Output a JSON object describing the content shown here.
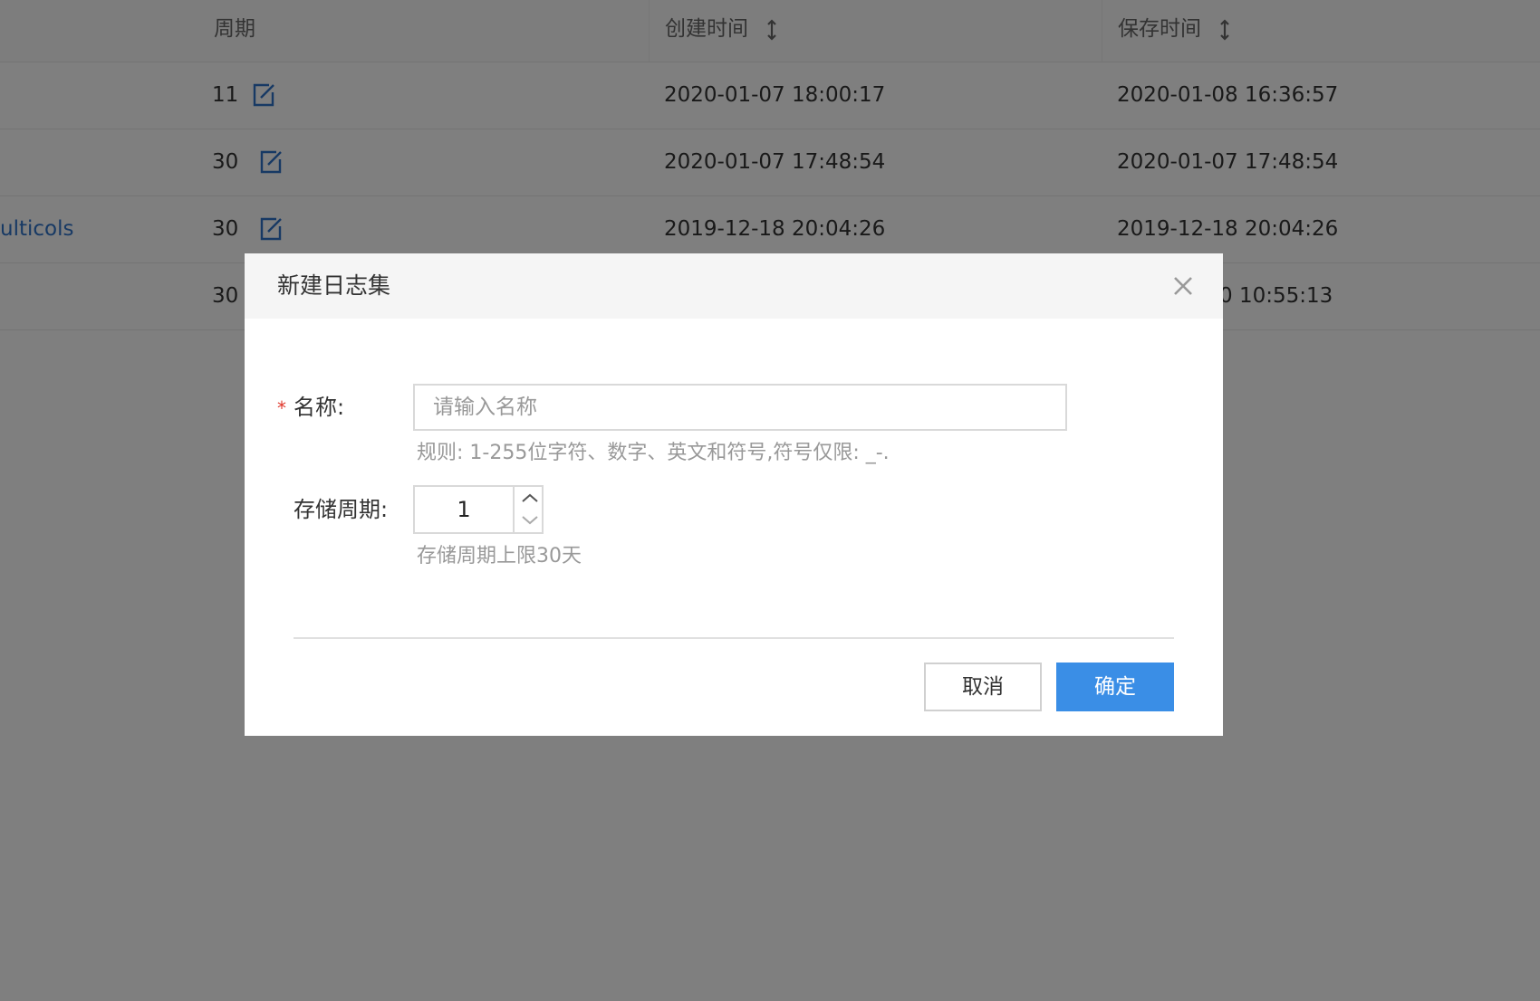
{
  "table": {
    "columns": {
      "period": "周期",
      "created_time": "创建时间",
      "saved_time": "保存时间"
    },
    "rows": [
      {
        "name": "",
        "period": "11",
        "created": "2020-01-07 18:00:17",
        "saved": "2020-01-08 16:36:57"
      },
      {
        "name": "",
        "period": "30",
        "created": "2020-01-07 17:48:54",
        "saved": "2020-01-07 17:48:54"
      },
      {
        "name": "ulticols",
        "period": "30",
        "created": "2019-12-18 20:04:26",
        "saved": "2019-12-18 20:04:26"
      },
      {
        "name": "",
        "period": "30",
        "created": "",
        "saved": "0 10:55:13"
      }
    ]
  },
  "modal": {
    "title": "新建日志集",
    "name_label": "名称:",
    "name_placeholder": "请输入名称",
    "name_value": "",
    "name_hint": "规则: 1-255位字符、数字、英文和符号,符号仅限: _-.",
    "period_label": "存储周期:",
    "period_value": "1",
    "period_hint": "存储周期上限30天",
    "cancel_label": "取消",
    "ok_label": "确定"
  },
  "colors": {
    "primary": "#3a8ee6",
    "link": "#2e72c9",
    "required": "#e0372b",
    "overlay": "rgba(0,0,0,0.5)"
  },
  "icons": {
    "edit": "edit-icon",
    "sort": "sort-icon",
    "close": "close-icon",
    "stepper_up": "chevron-up-icon",
    "stepper_down": "chevron-down-icon"
  }
}
